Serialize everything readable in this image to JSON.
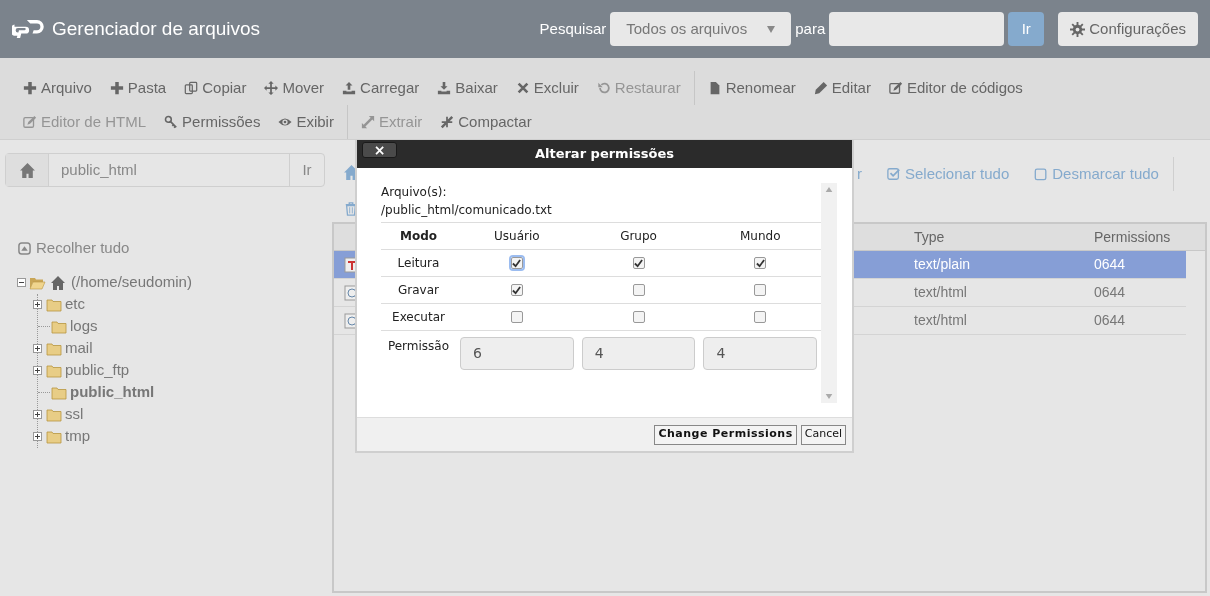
{
  "header": {
    "title": "Gerenciador de arquivos",
    "search_label": "Pesquisar",
    "search_scope": "Todos os arquivos",
    "for_label": "para",
    "go_button": "Ir",
    "settings_button": "Configurações"
  },
  "toolbar_rows": [
    [
      {
        "label": "Arquivo",
        "disabled": false,
        "group_start": false
      },
      {
        "label": "Pasta",
        "disabled": false,
        "group_start": false
      },
      {
        "label": "Copiar",
        "disabled": false,
        "group_start": false
      },
      {
        "label": "Mover",
        "disabled": false,
        "group_start": false
      },
      {
        "label": "Carregar",
        "disabled": false,
        "group_start": false
      },
      {
        "label": "Baixar",
        "disabled": false,
        "group_start": false
      },
      {
        "label": "Excluir",
        "disabled": false,
        "group_start": false
      },
      {
        "label": "Restaurar",
        "disabled": true,
        "group_start": false
      },
      {
        "label": "Renomear",
        "disabled": false,
        "group_start": true
      },
      {
        "label": "Editar",
        "disabled": false,
        "group_start": false
      },
      {
        "label": "Editor de códigos",
        "disabled": false,
        "group_start": false
      }
    ],
    [
      {
        "label": "Editor de HTML",
        "disabled": true,
        "group_start": false
      },
      {
        "label": "Permissões",
        "disabled": false,
        "group_start": false
      },
      {
        "label": "Exibir",
        "disabled": false,
        "group_start": false
      },
      {
        "label": "Extrair",
        "disabled": true,
        "group_start": true
      },
      {
        "label": "Compactar",
        "disabled": false,
        "group_start": false
      }
    ]
  ],
  "path_bar": {
    "path": "public_html",
    "go_button": "Ir"
  },
  "collapse_all": "Recolher tudo",
  "tree": {
    "label": "(/home/seudomin)",
    "expanded": true,
    "children": [
      {
        "label": "etc",
        "has_children": true,
        "selected": false
      },
      {
        "label": "logs",
        "has_children": false,
        "selected": false
      },
      {
        "label": "mail",
        "has_children": true,
        "selected": false
      },
      {
        "label": "public_ftp",
        "has_children": true,
        "selected": false
      },
      {
        "label": "public_html",
        "has_children": false,
        "selected": true
      },
      {
        "label": "ssl",
        "has_children": true,
        "selected": false
      },
      {
        "label": "tmp",
        "has_children": true,
        "selected": false
      }
    ]
  },
  "file_actions": [
    {
      "label": "r"
    },
    {
      "label": "Selecionar tudo"
    },
    {
      "label": "Desmarcar tudo"
    }
  ],
  "table": {
    "columns": [
      "Type",
      "Permissions"
    ],
    "rows": [
      {
        "kind": "text",
        "type": "text/plain",
        "permissions": "0644",
        "selected": true
      },
      {
        "kind": "html",
        "type": "text/html",
        "permissions": "0644",
        "selected": false
      },
      {
        "kind": "html",
        "type": "text/html",
        "permissions": "0644",
        "selected": false
      }
    ]
  },
  "dialog": {
    "title": "Alterar permissões",
    "close": "×",
    "file_label": "Arquivo(s):",
    "file_path": "/public_html/comunicado.txt",
    "columns": [
      "Modo",
      "Usuário",
      "Grupo",
      "Mundo"
    ],
    "modes": [
      {
        "label": "Leitura",
        "cells": [
          {
            "checked": true
          },
          {
            "checked": true
          },
          {
            "checked": true
          }
        ]
      },
      {
        "label": "Gravar",
        "cells": [
          {
            "checked": true
          },
          {
            "checked": false
          },
          {
            "checked": false
          }
        ]
      },
      {
        "label": "Executar",
        "cells": [
          {
            "checked": false
          },
          {
            "checked": false
          },
          {
            "checked": false
          }
        ]
      }
    ],
    "permission_label": "Permissão",
    "values": [
      "6",
      "4",
      "4"
    ],
    "buttons": [
      "Change Permissions",
      "Cancel"
    ]
  }
}
